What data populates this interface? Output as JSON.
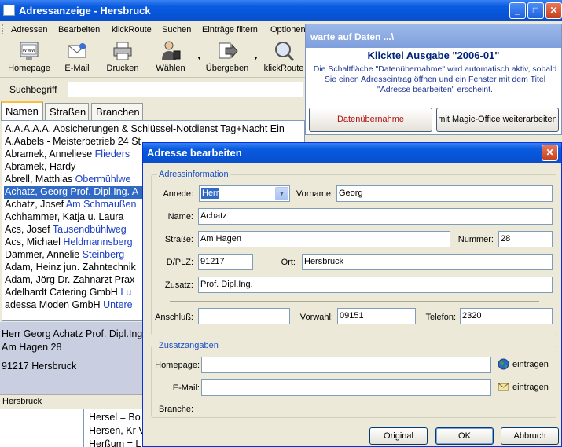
{
  "window": {
    "title": "Adressanzeige - Hersbruck"
  },
  "menu": [
    "Adressen",
    "Bearbeiten",
    "klickRoute",
    "Suchen",
    "Einträge filtern",
    "Optionen"
  ],
  "toolbar": {
    "homepage": "Homepage",
    "email": "E-Mail",
    "print": "Drucken",
    "dial": "Wählen",
    "transfer": "Übergeben",
    "klickroute": "klickRoute"
  },
  "search": {
    "label": "Suchbegriff",
    "value": ""
  },
  "tabs": [
    "Namen",
    "Straßen",
    "Branchen"
  ],
  "list": [
    {
      "name": "A.A.A.A.A. Absicherungen & Schlüssel-Notdienst Tag+Nacht Ein",
      "street": ""
    },
    {
      "name": "A.Aabels - Meisterbetrieb 24 St",
      "street": ""
    },
    {
      "name": "Abramek, Anneliese",
      "street": "Flieders"
    },
    {
      "name": "Abramek, Hardy",
      "street": ""
    },
    {
      "name": "Abrell, Matthias",
      "street": "Obermühlwe"
    },
    {
      "name": "Achatz, Georg Prof. Dipl.Ing.",
      "street": "A"
    },
    {
      "name": "Achatz, Josef",
      "street": "Am Schmaußen"
    },
    {
      "name": "Achhammer, Katja u. Laura",
      "street": ""
    },
    {
      "name": "Acs, Josef",
      "street": "Tausendbühlweg"
    },
    {
      "name": "Acs, Michael",
      "street": "Heldmannsberg"
    },
    {
      "name": "Dämmer, Annelie",
      "street": "Steinberg"
    },
    {
      "name": "Adam, Heinz jun. Zahntechnik",
      "street": ""
    },
    {
      "name": "Adam, Jörg Dr. Zahnarzt Prax",
      "street": ""
    },
    {
      "name": "Adelhardt Catering GmbH",
      "street": "Lu"
    },
    {
      "name": "adessa Moden GmbH",
      "street": "Untere"
    }
  ],
  "details": {
    "line1": "Herr Georg Achatz Prof. Dipl.Ing.",
    "line2": "Am Hagen 28",
    "line3": "91217 Hersbruck"
  },
  "status": {
    "place": "Hersbruck"
  },
  "bottom_list": [
    "Hersel = Bo",
    "Hersen, Kr V",
    "Herßum = L"
  ],
  "wait_panel": {
    "title": "warte auf Daten ...\\",
    "heading": "Klicktel Ausgabe \"2006-01\"",
    "text": "Die Schaltfläche \"Datenübernahme\" wird automatisch aktiv, sobald Sie einen Adresseintrag öffnen und ein Fenster mit dem Titel \"Adresse bearbeiten\" erscheint.",
    "btn_import": "Datenübernahme",
    "btn_continue": "mit Magic-Office weiterarbeiten"
  },
  "dialog": {
    "title": "Adresse bearbeiten",
    "group_address": "Adressinformation",
    "labels": {
      "anrede": "Anrede:",
      "vorname": "Vorname:",
      "name": "Name:",
      "strasse": "Straße:",
      "nummer": "Nummer:",
      "plz": "D/PLZ:",
      "ort": "Ort:",
      "zusatz": "Zusatz:",
      "anschluss": "Anschluß:",
      "vorwahl": "Vorwahl:",
      "telefon": "Telefon:"
    },
    "values": {
      "anrede": "Herr",
      "vorname": "Georg",
      "name": "Achatz",
      "strasse": "Am Hagen",
      "nummer": "28",
      "plz": "91217",
      "ort": "Hersbruck",
      "zusatz": "Prof. Dipl.Ing.",
      "anschluss": "",
      "vorwahl": "09151",
      "telefon": "2320"
    },
    "group_extra": "Zusatzangaben",
    "extra_labels": {
      "homepage": "Homepage:",
      "email": "E-Mail:",
      "branche": "Branche:"
    },
    "extra_values": {
      "homepage": "",
      "email": ""
    },
    "eintragen": "eintragen",
    "buttons": {
      "original": "Original",
      "ok": "OK",
      "cancel": "Abbruch"
    }
  }
}
